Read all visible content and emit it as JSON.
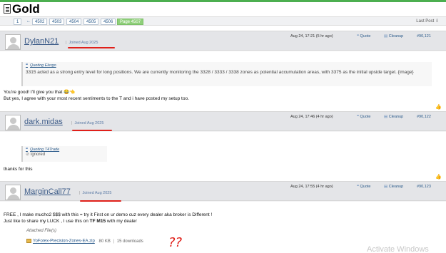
{
  "thread": {
    "title": "Gold"
  },
  "pagination": {
    "pages": [
      "1",
      "←",
      "4502",
      "4503",
      "4504",
      "4505",
      "4506"
    ],
    "current": "Page 4507",
    "last_post": "Last Post"
  },
  "posts": [
    {
      "username": "DylanN21",
      "joined": "Joined Aug 2025",
      "time": "Aug 24, 17:21 (5 hr ago)",
      "quote_label": "Quote",
      "cleanup_label": "Cleanup",
      "post_number": "#90,121",
      "quote": {
        "author": "Quoting Elergo",
        "text": "3315 acted as a strong entry level for long positions. We are currently monitoring the 3328 / 3333 / 3338 zones as potential accumulation areas, with 3375 as the initial upside target. {image}"
      },
      "message_lines": [
        "You're good! I'll give you that 😂👈",
        "But yes, I agree with your most recent sentiments to the T and i have posted my setup too."
      ]
    },
    {
      "username": "dark.midas",
      "joined": "Joined Aug 2025",
      "time": "Aug 24, 17:46 (4 hr ago)",
      "quote_label": "Quote",
      "cleanup_label": "Cleanup",
      "post_number": "#90,122",
      "quote": {
        "author": "Quoting T4Trade",
        "text": "Ignored"
      },
      "message_lines": [
        "thanks for this"
      ]
    },
    {
      "username": "MarginCall77",
      "joined": "Joined Aug 2025",
      "time": "Aug 24, 17:55 (4 hr ago)",
      "quote_label": "Quote",
      "cleanup_label": "Cleanup",
      "post_number": "#90,123",
      "message_lines": [
        "FREE , I make mucho2 $$$ with this = try it First on ur demo cuz every dealer aka broker is Different !",
        "Just like to share my LUCK , I use this on TF M15 with my dealer"
      ],
      "attachments_label": "Attached File(s)",
      "attachment": {
        "name": "YoForex-Precision-Zones-EA.zip",
        "size": "80 KB",
        "downloads": "15 downloads"
      },
      "handwritten": "??"
    }
  ],
  "watermark": "Activate Windows"
}
